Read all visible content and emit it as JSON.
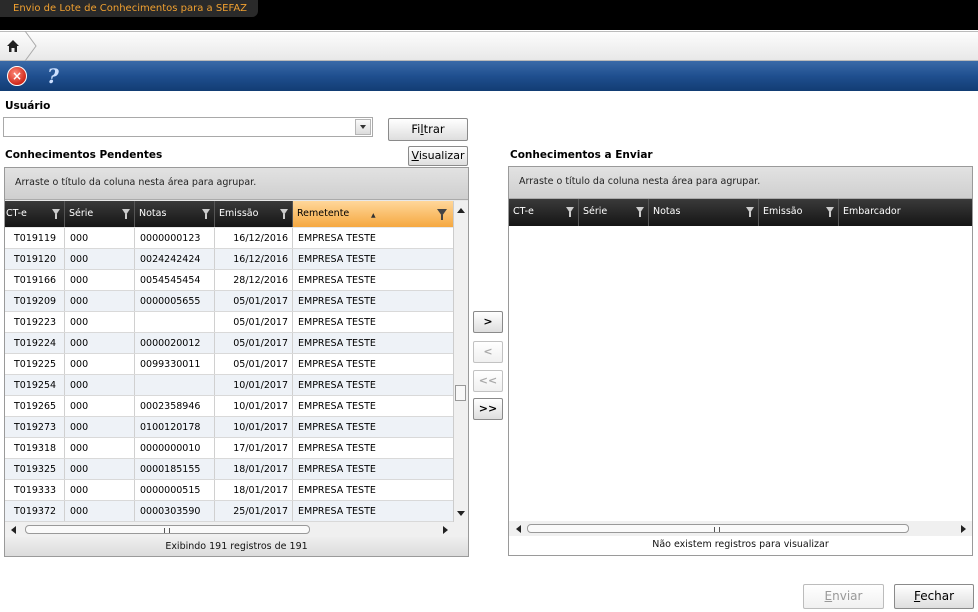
{
  "window": {
    "title": "Envio de Lote de Conhecimentos para a SEFAZ"
  },
  "breadcrumb": {
    "home_icon": "home-icon"
  },
  "toolbar": {
    "close_icon": "close-icon",
    "help_icon": "help-icon",
    "close_glyph": "×",
    "help_glyph": "?"
  },
  "filter": {
    "usuario_label": "Usuário",
    "usuario_value": "",
    "filtrar_label_pre": "Fi",
    "filtrar_label_u": "l",
    "filtrar_label_post": "trar",
    "visualizar_label_pre": "",
    "visualizar_label_u": "V",
    "visualizar_label_post": "isualizar"
  },
  "pending": {
    "title": "Conhecimentos Pendentes",
    "group_hint": "Arraste o título da coluna nesta área para agrupar.",
    "columns": [
      "CT-e",
      "Série",
      "Notas",
      "Emissão",
      "Remetente"
    ],
    "sorted_column": "Remetente",
    "rows": [
      [
        "T019119",
        "000",
        "0000000123",
        "16/12/2016",
        "EMPRESA TESTE"
      ],
      [
        "T019120",
        "000",
        "0024242424",
        "16/12/2016",
        "EMPRESA TESTE"
      ],
      [
        "T019166",
        "000",
        "0054545454",
        "28/12/2016",
        "EMPRESA TESTE"
      ],
      [
        "T019209",
        "000",
        "0000005655",
        "05/01/2017",
        "EMPRESA TESTE"
      ],
      [
        "T019223",
        "000",
        "",
        "05/01/2017",
        "EMPRESA TESTE"
      ],
      [
        "T019224",
        "000",
        "0000020012",
        "05/01/2017",
        "EMPRESA TESTE"
      ],
      [
        "T019225",
        "000",
        "0099330011",
        "05/01/2017",
        "EMPRESA TESTE"
      ],
      [
        "T019254",
        "000",
        "",
        "10/01/2017",
        "EMPRESA TESTE"
      ],
      [
        "T019265",
        "000",
        "0002358946",
        "10/01/2017",
        "EMPRESA TESTE"
      ],
      [
        "T019273",
        "000",
        "0100120178",
        "10/01/2017",
        "EMPRESA TESTE"
      ],
      [
        "T019318",
        "000",
        "0000000010",
        "17/01/2017",
        "EMPRESA TESTE"
      ],
      [
        "T019325",
        "000",
        "0000185155",
        "18/01/2017",
        "EMPRESA TESTE"
      ],
      [
        "T019333",
        "000",
        "0000000515",
        "18/01/2017",
        "EMPRESA TESTE"
      ],
      [
        "T019372",
        "000",
        "0000303590",
        "25/01/2017",
        "EMPRESA TESTE"
      ]
    ],
    "footer": "Exibindo 191 registros de 191"
  },
  "to_send": {
    "title": "Conhecimentos a Enviar",
    "group_hint": "Arraste o título da coluna nesta área para agrupar.",
    "columns": [
      "CT-e",
      "Série",
      "Notas",
      "Emissão",
      "Embarcador"
    ],
    "footer": "Não existem registros para visualizar"
  },
  "transfer": {
    "add": ">",
    "remove": "<",
    "remove_all": "<<",
    "add_all": ">>"
  },
  "actions": {
    "enviar_pre": "",
    "enviar_u": "E",
    "enviar_post": "nviar",
    "fechar_pre": "",
    "fechar_u": "F",
    "fechar_post": "echar"
  },
  "colors": {
    "accent": "#f5a840",
    "toolbar": "#1f4f8f",
    "title_text": "#f0a030"
  }
}
